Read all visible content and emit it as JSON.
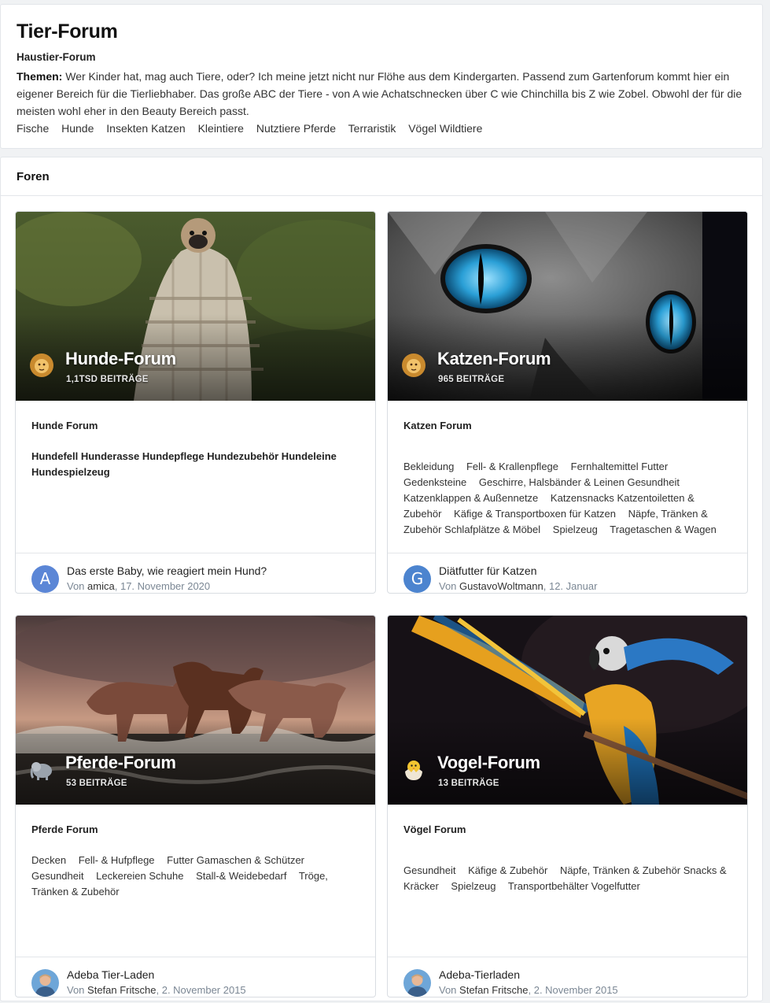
{
  "intro": {
    "title": "Tier-Forum",
    "subtitle": "Haustier-Forum",
    "themes_label": "Themen:",
    "description": "Wer Kinder hat, mag auch Tiere, oder? Ich meine jetzt nicht nur Flöhe aus dem Kindergarten. Passend zum Gartenforum kommt hier ein eigener Bereich für die Tierliebhaber. Das große ABC der Tiere - von A wie Achatschnecken über C wie Chinchilla bis Z wie Zobel. Obwohl der für die meisten wohl eher in den Beauty Bereich passt.",
    "tags": [
      "Fische",
      "Hunde",
      "Insekten Katzen",
      "Kleintiere",
      "Nutztiere Pferde",
      "Terraristik",
      "Vögel  Wildtiere"
    ]
  },
  "forums_header": "Foren",
  "cards": [
    {
      "title": "Hunde-Forum",
      "count": "1,1TSD BEITRÄGE",
      "icon": "lion-icon",
      "label": "Hunde Forum",
      "bold_tags": "Hundefell Hunderasse Hundepflege Hundezubehör Hundeleine Hundespielzeug",
      "tags": [],
      "last_title": "Das erste Baby, wie reagiert mein Hund?",
      "last_by": "Von",
      "last_user": "amica",
      "last_date": ", 17. November 2020",
      "avatar": "A"
    },
    {
      "title": "Katzen-Forum",
      "count": "965 BEITRÄGE",
      "icon": "lion-icon",
      "label": "Katzen Forum",
      "bold_tags": "",
      "tags": [
        "Bekleidung",
        "Fell- & Krallenpflege",
        "Fernhaltemittel Futter",
        "Gedenksteine",
        "Geschirre, Halsbänder & Leinen Gesundheit",
        "Katzenklappen & Außennetze",
        "Katzensnacks Katzentoiletten & Zubehör",
        "Käfige & Transportboxen für Katzen",
        "Näpfe, Tränken & Zubehör Schlafplätze & Möbel",
        "Spielzeug",
        "Tragetaschen & Wagen"
      ],
      "last_title": "Diätfutter für Katzen",
      "last_by": "Von",
      "last_user": "GustavoWoltmann",
      "last_date": ", 12. Januar",
      "avatar": "G"
    },
    {
      "title": "Pferde-Forum",
      "count": "53 BEITRÄGE",
      "icon": "elephant-icon",
      "label": "Pferde Forum",
      "bold_tags": "",
      "tags": [
        "Decken",
        "Fell- & Hufpflege",
        "Futter Gamaschen & Schützer",
        "Gesundheit",
        "Leckereien Schuhe",
        "Stall-& Weidebedarf",
        "Tröge, Tränken & Zubehör"
      ],
      "last_title": "Adeba Tier-Laden",
      "last_by": "Von",
      "last_user": "Stefan Fritsche",
      "last_date": ", 2. November 2015",
      "avatar": ""
    },
    {
      "title": "Vogel-Forum",
      "count": "13 BEITRÄGE",
      "icon": "chick-icon",
      "label": "Vögel Forum",
      "bold_tags": "",
      "tags": [
        "Gesundheit",
        "Käfige & Zubehör",
        "Näpfe, Tränken & Zubehör Snacks & Kräcker",
        "Spielzeug",
        "Transportbehälter Vogelfutter"
      ],
      "last_title": "Adeba-Tierladen",
      "last_by": "Von",
      "last_user": "Stefan Fritsche",
      "last_date": ", 2. November 2015",
      "avatar": ""
    }
  ]
}
